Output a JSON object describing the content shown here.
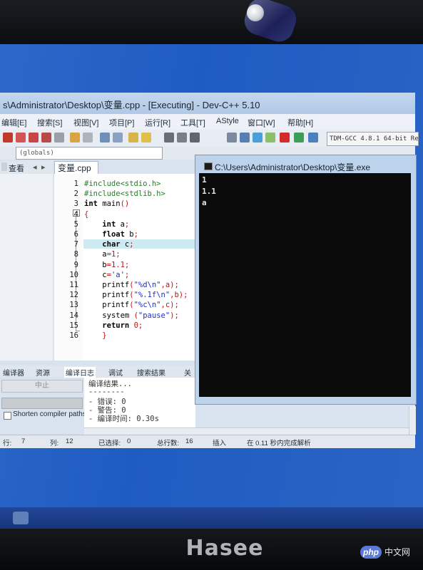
{
  "window": {
    "title": "s\\Administrator\\Desktop\\变量.cpp - [Executing] - Dev-C++ 5.10"
  },
  "menu": [
    "编辑[E]",
    "搜索[S]",
    "视图[V]",
    "项目[P]",
    "运行[R]",
    "工具[T]",
    "AStyle",
    "窗口[W]",
    "帮助[H]"
  ],
  "toolbar": {
    "compiler": "TDM-GCC 4.8.1 64-bit Release",
    "scope": "(globals)"
  },
  "left_tab": "查看",
  "editor": {
    "file_tab": "变量.cpp",
    "line_numbers": [
      "1",
      "2",
      "3",
      "4",
      "5",
      "6",
      "7",
      "8",
      "9",
      "10",
      "11",
      "12",
      "13",
      "14",
      "15",
      "16"
    ],
    "lines": [
      {
        "indent": "",
        "parts": [
          {
            "t": "#include<stdio.h>",
            "c": "pp"
          }
        ]
      },
      {
        "indent": "",
        "parts": [
          {
            "t": "#include<stdlib.h>",
            "c": "pp"
          }
        ]
      },
      {
        "indent": "",
        "parts": [
          {
            "t": "int",
            "c": "kw"
          },
          {
            "t": " main",
            "c": ""
          },
          {
            "t": "()",
            "c": "sym"
          }
        ]
      },
      {
        "indent": "",
        "parts": [
          {
            "t": "{",
            "c": "sym"
          }
        ]
      },
      {
        "indent": "    ",
        "parts": [
          {
            "t": "int",
            "c": "kw"
          },
          {
            "t": " a",
            "c": ""
          },
          {
            "t": ";",
            "c": "sym"
          }
        ]
      },
      {
        "indent": "    ",
        "parts": [
          {
            "t": "float",
            "c": "kw"
          },
          {
            "t": " b",
            "c": ""
          },
          {
            "t": ";",
            "c": "sym"
          }
        ]
      },
      {
        "indent": "    ",
        "parts": [
          {
            "t": "char",
            "c": "kw"
          },
          {
            "t": " c",
            "c": ""
          },
          {
            "t": ";",
            "c": "sym"
          }
        ]
      },
      {
        "indent": "    ",
        "parts": [
          {
            "t": "a",
            "c": ""
          },
          {
            "t": "=",
            "c": "sym"
          },
          {
            "t": "1",
            "c": "num"
          },
          {
            "t": ";",
            "c": "sym"
          }
        ]
      },
      {
        "indent": "    ",
        "parts": [
          {
            "t": "b",
            "c": ""
          },
          {
            "t": "=",
            "c": "sym"
          },
          {
            "t": "1.1",
            "c": "num"
          },
          {
            "t": ";",
            "c": "sym"
          }
        ]
      },
      {
        "indent": "    ",
        "parts": [
          {
            "t": "c",
            "c": ""
          },
          {
            "t": "=",
            "c": "sym"
          },
          {
            "t": "'a'",
            "c": "str"
          },
          {
            "t": ";",
            "c": "sym"
          }
        ]
      },
      {
        "indent": "    ",
        "parts": [
          {
            "t": "printf",
            "c": ""
          },
          {
            "t": "(",
            "c": "sym"
          },
          {
            "t": "\"%d\\n\"",
            "c": "str"
          },
          {
            "t": ",a);",
            "c": "sym"
          }
        ]
      },
      {
        "indent": "    ",
        "parts": [
          {
            "t": "printf",
            "c": ""
          },
          {
            "t": "(",
            "c": "sym"
          },
          {
            "t": "\"%.1f\\n\"",
            "c": "str"
          },
          {
            "t": ",b);",
            "c": "sym"
          }
        ]
      },
      {
        "indent": "    ",
        "parts": [
          {
            "t": "printf",
            "c": ""
          },
          {
            "t": "(",
            "c": "sym"
          },
          {
            "t": "\"%c\\n\"",
            "c": "str"
          },
          {
            "t": ",c);",
            "c": "sym"
          }
        ]
      },
      {
        "indent": "    ",
        "parts": [
          {
            "t": "system ",
            "c": ""
          },
          {
            "t": "(",
            "c": "sym"
          },
          {
            "t": "\"pause\"",
            "c": "str"
          },
          {
            "t": ");",
            "c": "sym"
          }
        ]
      },
      {
        "indent": "    ",
        "parts": [
          {
            "t": "return",
            "c": "kw"
          },
          {
            "t": " ",
            "c": ""
          },
          {
            "t": "0",
            "c": "num"
          },
          {
            "t": ";",
            "c": "sym"
          }
        ]
      },
      {
        "indent": "    ",
        "parts": [
          {
            "t": "}",
            "c": "sym"
          }
        ]
      }
    ]
  },
  "bottom_tabs": [
    "编译器",
    "资源",
    "编译日志",
    "调试",
    "搜索结果",
    "关"
  ],
  "compile_panel": {
    "stop_button": "中止",
    "shorten_label": "Shorten compiler paths",
    "log": [
      "编译结果...",
      "--------",
      "- 错误: 0",
      "- 警告: 0",
      "- 编译时间: 0.30s"
    ]
  },
  "status": {
    "row_label": "行:",
    "row": "7",
    "col_label": "列:",
    "col": "12",
    "selected_label": "已选择:",
    "selected": "0",
    "total_label": "总行数:",
    "total": "16",
    "mode": "插入",
    "parse": "在 0.11 秒内完成解析"
  },
  "console": {
    "title": "C:\\Users\\Administrator\\Desktop\\变量.exe",
    "output": [
      "1",
      "1.1",
      "a"
    ]
  },
  "brand": "Hasee",
  "watermark": {
    "badge": "php",
    "text": "中文网"
  }
}
